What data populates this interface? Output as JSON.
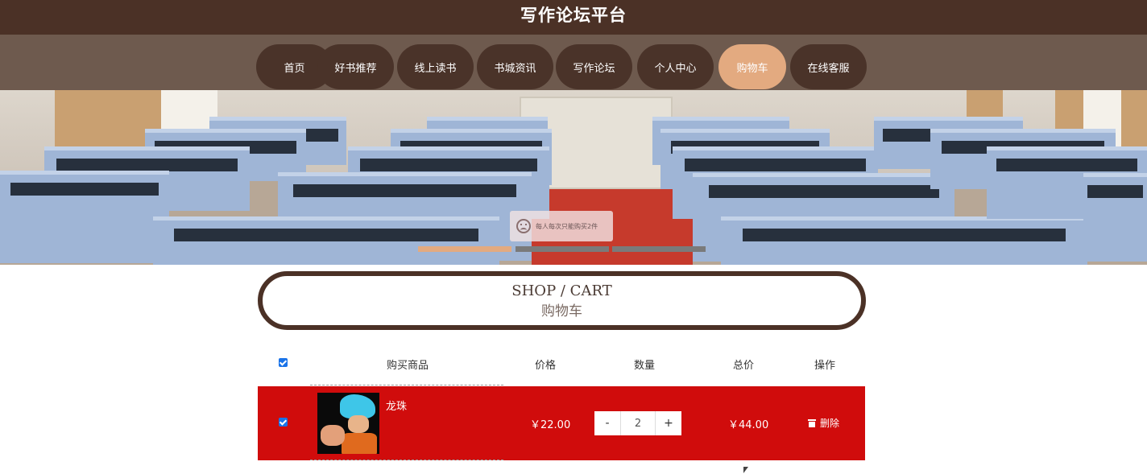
{
  "site": {
    "title": "写作论坛平台"
  },
  "nav": {
    "items": [
      {
        "label": "首页"
      },
      {
        "label": "好书推荐"
      },
      {
        "label": "线上读书"
      },
      {
        "label": "书城资讯"
      },
      {
        "label": "写作论坛"
      },
      {
        "label": "个人中心"
      },
      {
        "label": "购物车",
        "active": true
      },
      {
        "label": "在线客服"
      }
    ]
  },
  "banner": {
    "toast": "每人每次只能购买2件",
    "carousel": {
      "slides": 3,
      "active": 1
    }
  },
  "section": {
    "title_en": "SHOP / CART",
    "title_cn": "购物车"
  },
  "cart": {
    "headers": {
      "product": "购买商品",
      "price": "价格",
      "quantity": "数量",
      "total": "总价",
      "action": "操作"
    },
    "select_all": true,
    "items": [
      {
        "name": "龙珠",
        "price": "￥22.00",
        "quantity": "2",
        "total": "￥44.00",
        "selected": true,
        "delete_label": "删除"
      }
    ],
    "minus_label": "-",
    "plus_label": "+"
  },
  "colors": {
    "header": "#4b3126",
    "nav_bg": "#6e5a4e",
    "nav_pill": "#4a3329",
    "accent": "#e3aa80",
    "row_highlight": "#d00c0c"
  }
}
